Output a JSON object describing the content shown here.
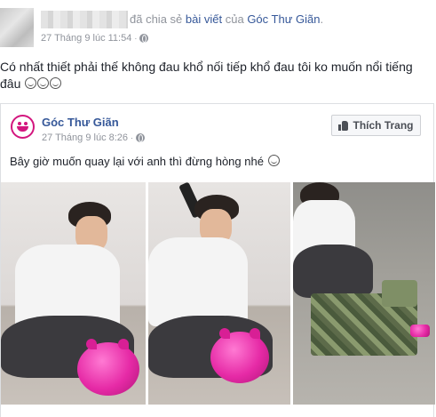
{
  "post": {
    "share_text": "đã chia sẻ",
    "share_link": "bài viết",
    "of_text": "của",
    "page_link": "Góc Thư Giãn",
    "share_period": ".",
    "timestamp": "27 Tháng 9 lúc 11:54",
    "separator": "·",
    "privacy_icon": "globe-icon",
    "message": "Có nhất thiết phải thế không đau khổ nối tiếp khổ đau tôi ko muốn nổi tiếng đâu"
  },
  "shared": {
    "page_name": "Góc Thư Giãn",
    "timestamp": "27 Tháng 9 lúc 8:26",
    "separator": "·",
    "like_page_label": "Thích Trang",
    "caption": "Bây giờ muốn quay lại với anh thì đừng hòng nhé"
  },
  "colors": {
    "link": "#365899",
    "muted": "#90949c",
    "text": "#1d2129",
    "page_brand": "#d3167e"
  }
}
